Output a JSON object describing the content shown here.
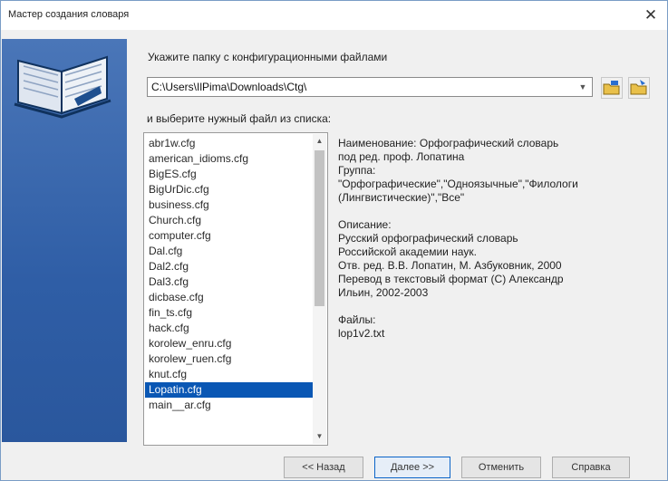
{
  "window": {
    "title": "Мастер создания словаря",
    "close_glyph": "✕"
  },
  "sidebar": {
    "icon": "open-book-icon"
  },
  "folder": {
    "label": "Укажите папку с конфигурационными файлами",
    "path_value": "C:\\Users\\IlPima\\Downloads\\Ctg\\",
    "browse_icon": "folder-browse-icon",
    "open_icon": "folder-open-icon"
  },
  "list_label": "и выберите нужный файл из списка:",
  "files": [
    "abr1w.cfg",
    "american_idioms.cfg",
    "BigES.cfg",
    "BigUrDic.cfg",
    "business.cfg",
    "Church.cfg",
    "computer.cfg",
    "Dal.cfg",
    "Dal2.cfg",
    "Dal3.cfg",
    "dicbase.cfg",
    "fin_ts.cfg",
    "hack.cfg",
    "korolew_enru.cfg",
    "korolew_ruen.cfg",
    "knut.cfg",
    "Lopatin.cfg",
    "main__ar.cfg"
  ],
  "selected_file": "Lopatin.cfg",
  "details": {
    "name_line1": "Наименование: Орфографический словарь",
    "name_line2": "под ред. проф. Лопатина",
    "group_label": "Группа:",
    "group_line1": "\"Орфографические\",\"Одноязычные\",\"Филологи",
    "group_line2": "(Лингвистические)\",\"Все\"",
    "desc_label": "Описание:",
    "desc_line1": "Русский орфографический словарь",
    "desc_line2": "Российской академии наук.",
    "desc_line3": "Отв. ред. В.В. Лопатин, М. Азбуковник, 2000",
    "desc_line4": "Перевод в текстовый формат (С) Александр",
    "desc_line5": "Ильин, 2002-2003",
    "files_label": "Файлы:",
    "files_value": "lop1v2.txt"
  },
  "buttons": {
    "back": "<< Назад",
    "next": "Далее >>",
    "cancel": "Отменить",
    "help": "Справка"
  }
}
